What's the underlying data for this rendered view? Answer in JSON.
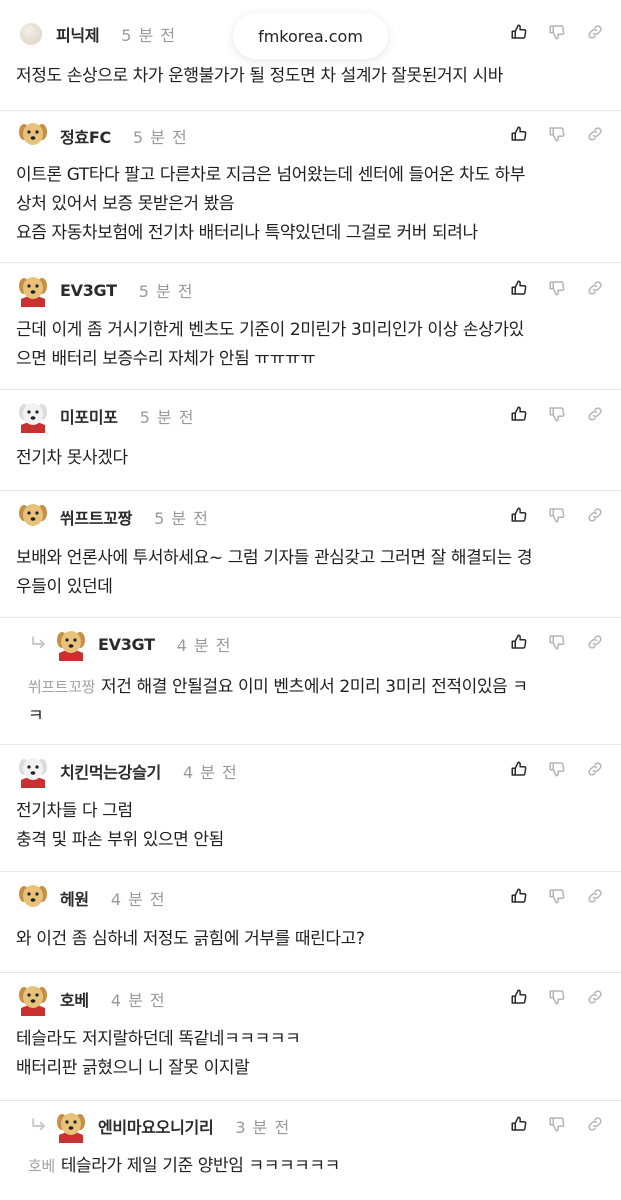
{
  "site": {
    "domain": "fmkorea.com"
  },
  "comments": [
    {
      "author": "피닉제",
      "time": "5 분 전",
      "avatar": "plain",
      "reply": false,
      "lines": [
        "저정도 손상으로 차가 운행불가가 될 정도면 차 설계가 잘못된거지 시바"
      ]
    },
    {
      "author": "정효FC",
      "time": "5 분 전",
      "avatar": "dog",
      "reply": false,
      "lines": [
        "이트론 GT타다 팔고 다른차로 지금은 넘어왔는데 센터에 들어온 차도 하부",
        "상처 있어서 보증 못받은거 봤음",
        "요즘 자동차보험에 전기차 배터리나 특약있던데 그걸로 커버 되려나"
      ]
    },
    {
      "author": "EV3GT",
      "time": "5 분 전",
      "avatar": "dog-cape",
      "reply": false,
      "lines": [
        "근데 이게 좀 거시기한게 벤츠도 기준이 2미린가 3미리인가 이상 손상가있",
        "으면 배터리 보증수리 자체가 안됨 ㅠㅠㅠㅠ"
      ]
    },
    {
      "author": "미포미포",
      "time": "5 분 전",
      "avatar": "white-dog",
      "reply": false,
      "lines": [
        "전기차 못사겠다"
      ]
    },
    {
      "author": "쒸프트꼬짱",
      "time": "5 분 전",
      "avatar": "dog",
      "reply": false,
      "lines": [
        "보배와 언론사에 투서하세요~ 그럼 기자들 관심갖고 그러면 잘 해결되는 경",
        "우들이 있던데"
      ]
    },
    {
      "author": "EV3GT",
      "time": "4 분 전",
      "avatar": "dog-cape",
      "reply": true,
      "mention": "쒸프트꼬짱",
      "lines": [
        "저건 해결 안될걸요 이미 벤츠에서 2미리 3미리 전적이있음 ㅋ",
        "ㅋ"
      ]
    },
    {
      "author": "치킨먹는강슬기",
      "time": "4 분 전",
      "avatar": "white-dog",
      "reply": false,
      "lines": [
        "전기차들 다 그럼",
        "충격 및 파손 부위 있으면 안됨"
      ]
    },
    {
      "author": "헤원",
      "time": "4 분 전",
      "avatar": "dog",
      "reply": false,
      "lines": [
        "와 이건 좀 심하네 저정도 긁힘에 거부를 때린다고?"
      ]
    },
    {
      "author": "호베",
      "time": "4 분 전",
      "avatar": "dog-cape",
      "reply": false,
      "lines": [
        "테슬라도 저지랄하던데 똑같네ㅋㅋㅋㅋㅋ",
        "배터리판 긁혔으니 니 잘못 이지랄"
      ]
    },
    {
      "author": "엔비마요오니기리",
      "time": "3 분 전",
      "avatar": "dog-cape",
      "reply": true,
      "mention": "호베",
      "lines": [
        "테슬라가 제일 기준 양반임 ㅋㅋㅋㅋㅋㅋ"
      ]
    }
  ],
  "icons": {
    "like": "thumbs-up-icon",
    "dislike": "thumbs-down-icon",
    "link": "link-icon",
    "reply": "reply-arrow-icon"
  }
}
